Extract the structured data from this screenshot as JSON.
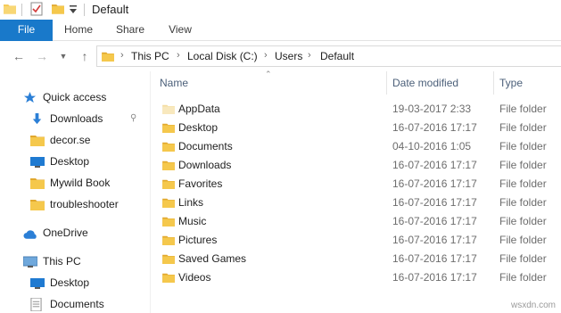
{
  "window": {
    "title": "Default"
  },
  "ribbon": {
    "tabs": [
      "File",
      "Home",
      "Share",
      "View"
    ]
  },
  "address": {
    "breadcrumbs": [
      "This PC",
      "Local Disk (C:)",
      "Users",
      "Default"
    ]
  },
  "nav": {
    "quick_access": "Quick access",
    "items": [
      "Downloads",
      "decor.se",
      "Desktop",
      "Mywild Book",
      "troubleshooter"
    ],
    "onedrive": "OneDrive",
    "this_pc": "This PC",
    "pc_items": [
      "Desktop",
      "Documents"
    ]
  },
  "columns": {
    "name": "Name",
    "date": "Date modified",
    "type": "Type"
  },
  "files": [
    {
      "name": "AppData",
      "date": "19-03-2017 2:33",
      "type": "File folder"
    },
    {
      "name": "Desktop",
      "date": "16-07-2016 17:17",
      "type": "File folder"
    },
    {
      "name": "Documents",
      "date": "04-10-2016 1:05",
      "type": "File folder"
    },
    {
      "name": "Downloads",
      "date": "16-07-2016 17:17",
      "type": "File folder"
    },
    {
      "name": "Favorites",
      "date": "16-07-2016 17:17",
      "type": "File folder"
    },
    {
      "name": "Links",
      "date": "16-07-2016 17:17",
      "type": "File folder"
    },
    {
      "name": "Music",
      "date": "16-07-2016 17:17",
      "type": "File folder"
    },
    {
      "name": "Pictures",
      "date": "16-07-2016 17:17",
      "type": "File folder"
    },
    {
      "name": "Saved Games",
      "date": "16-07-2016 17:17",
      "type": "File folder"
    },
    {
      "name": "Videos",
      "date": "16-07-2016 17:17",
      "type": "File folder"
    }
  ],
  "watermark": "wsxdn.com",
  "colors": {
    "accent": "#1979ca",
    "folder": "#f5c84c",
    "folder_dark": "#e1a82e"
  }
}
